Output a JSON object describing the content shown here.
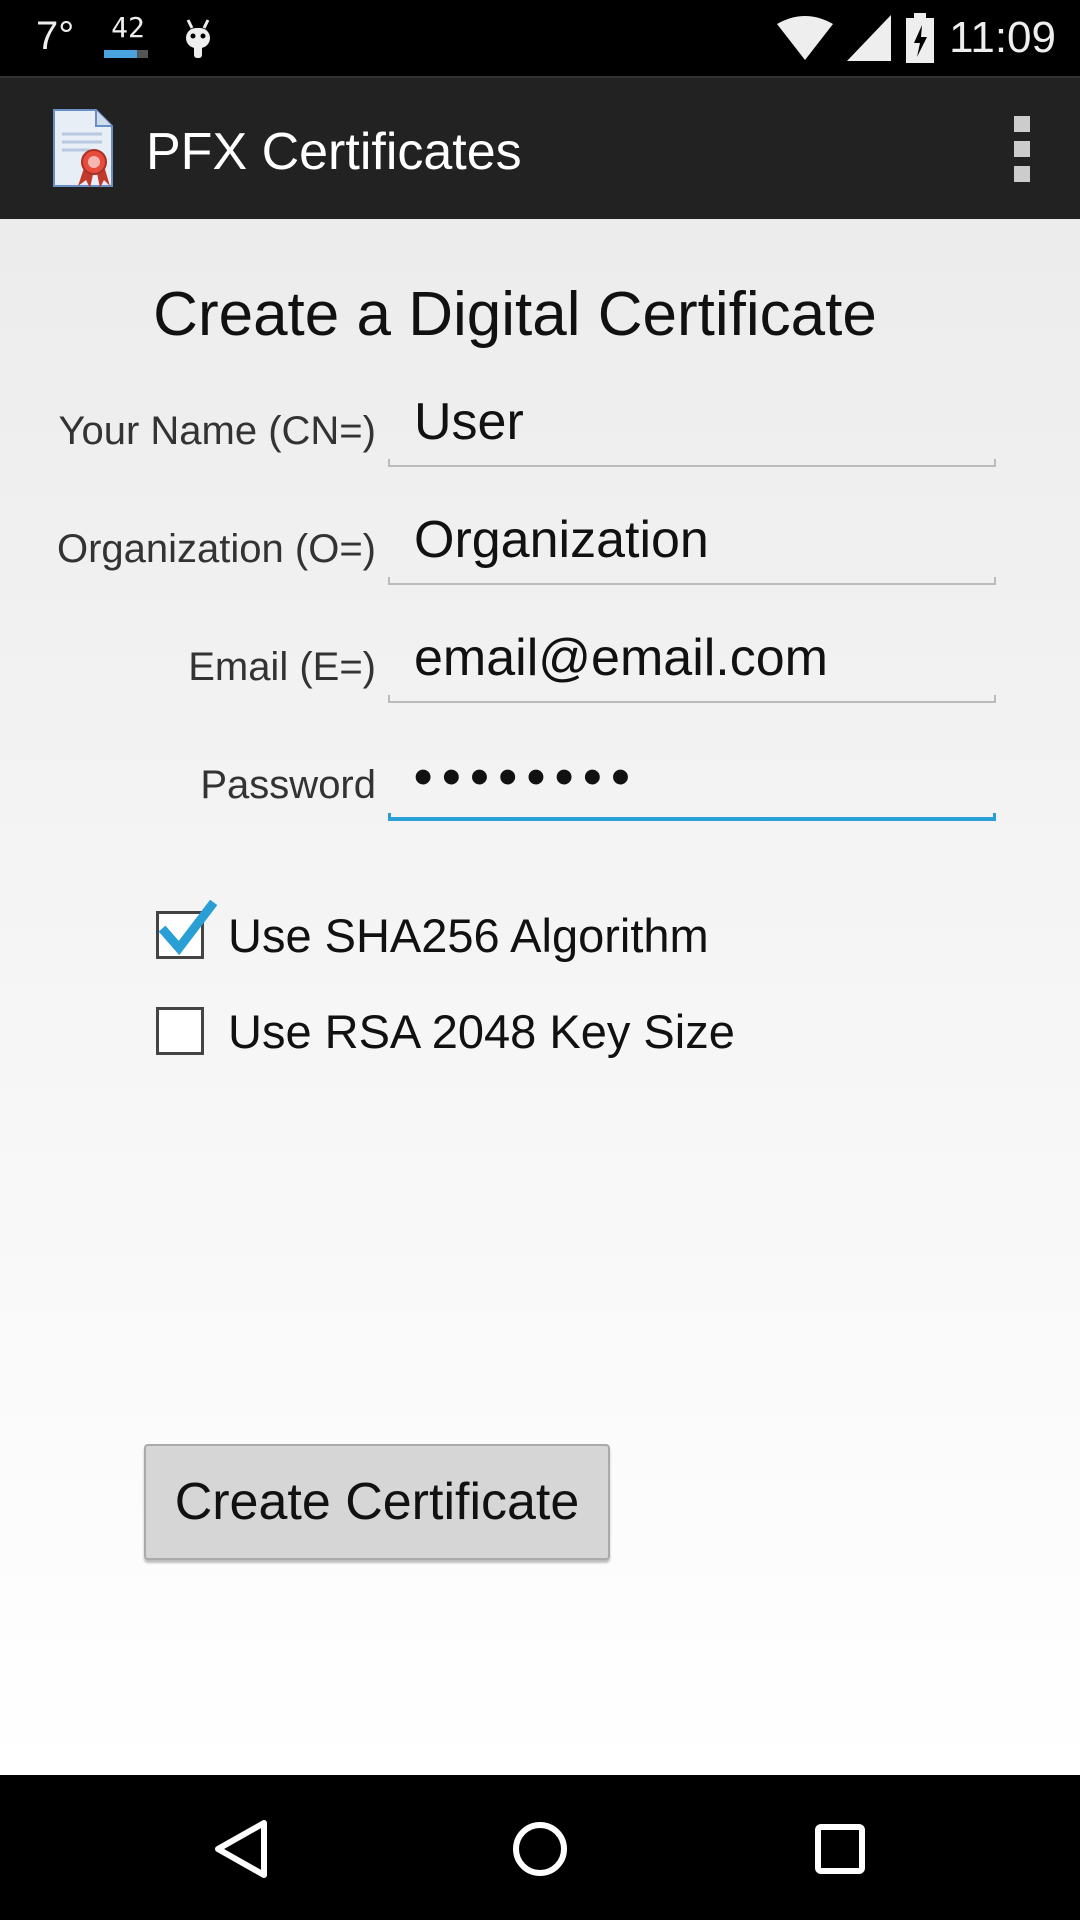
{
  "status_bar": {
    "temperature": "7°",
    "notification_count": "42",
    "count_progress": 0.75,
    "time": "11:09",
    "icons": [
      "android-icon",
      "wifi-icon",
      "signal-icon",
      "battery-icon"
    ]
  },
  "app_bar": {
    "title": "PFX Certificates",
    "icon": "certificate-icon",
    "menu_icon": "overflow-menu-icon"
  },
  "form": {
    "heading": "Create a Digital Certificate",
    "fields": [
      {
        "label": "Your Name (CN=)",
        "value": "User"
      },
      {
        "label": "Organization (O=)",
        "value": "Organization"
      },
      {
        "label": "Email (E=)",
        "value": "email@email.com"
      },
      {
        "label": "Password",
        "value": "••••••••"
      }
    ],
    "options": [
      {
        "label": "Use SHA256 Algorithm",
        "checked": true
      },
      {
        "label": "Use RSA 2048 Key Size",
        "checked": false
      }
    ],
    "submit_label": "Create Certificate"
  },
  "colors": {
    "accent": "#2a9fd6",
    "app_bar": "#222222",
    "button": "#d6d6d6"
  },
  "nav_bar": {
    "icons": [
      "back-icon",
      "home-icon",
      "recents-icon"
    ]
  }
}
